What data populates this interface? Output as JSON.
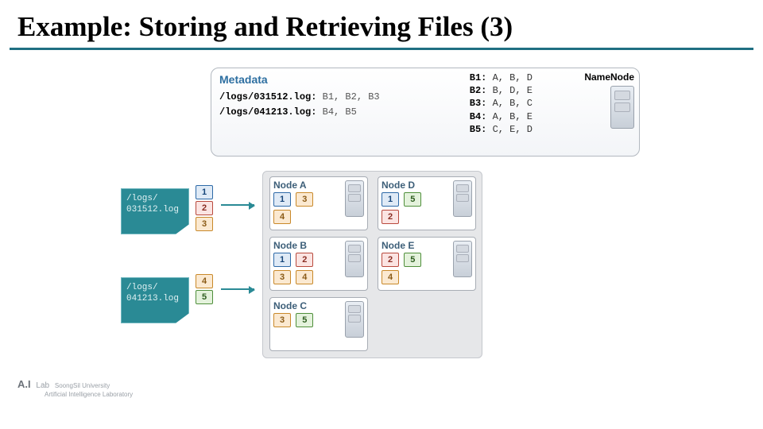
{
  "title": "Example: Storing and Retrieving Files (3)",
  "metadata": {
    "heading": "Metadata",
    "files": [
      {
        "path": "/logs/031512.log:",
        "blocks": "B1, B2, B3"
      },
      {
        "path": "/logs/041213.log:",
        "blocks": "B4, B5"
      }
    ],
    "block_map": [
      {
        "b": "B1:",
        "v": "A, B, D"
      },
      {
        "b": "B2:",
        "v": "B, D, E"
      },
      {
        "b": "B3:",
        "v": "A, B, C"
      },
      {
        "b": "B4:",
        "v": "A, B, E"
      },
      {
        "b": "B5:",
        "v": "C, E, D"
      }
    ],
    "namenode_label": "NameNode"
  },
  "file_shapes": {
    "f1_line1": "/logs/",
    "f1_line2": "031512.log",
    "f2_line1": "/logs/",
    "f2_line2": "041213.log"
  },
  "file_block_labels": {
    "b1": "1",
    "b2": "2",
    "b3": "3",
    "b4": "4",
    "b5": "5"
  },
  "nodes": {
    "A": {
      "title": "Node A",
      "row1": [
        [
          "1",
          "c-blue"
        ],
        [
          "3",
          "c-orange"
        ]
      ],
      "row2": [
        [
          "4",
          "c-orange"
        ]
      ]
    },
    "B": {
      "title": "Node B",
      "row1": [
        [
          "1",
          "c-blue"
        ],
        [
          "2",
          "c-red"
        ]
      ],
      "row2": [
        [
          "3",
          "c-orange"
        ],
        [
          "4",
          "c-orange"
        ]
      ]
    },
    "C": {
      "title": "Node C",
      "row1": [
        [
          "3",
          "c-orange"
        ],
        [
          "5",
          "c-green"
        ]
      ],
      "row2": []
    },
    "D": {
      "title": "Node D",
      "row1": [
        [
          "1",
          "c-blue"
        ],
        [
          "5",
          "c-green"
        ]
      ],
      "row2": [
        [
          "2",
          "c-red"
        ]
      ]
    },
    "E": {
      "title": "Node E",
      "row1": [
        [
          "2",
          "c-red"
        ],
        [
          "5",
          "c-green"
        ]
      ],
      "row2": [
        [
          "4",
          "c-orange"
        ]
      ]
    }
  },
  "footer": {
    "brand": "A.I",
    "text1": "Lab",
    "text2": "SoongSil University",
    "text3": "Artificial Intelligence Laboratory"
  }
}
